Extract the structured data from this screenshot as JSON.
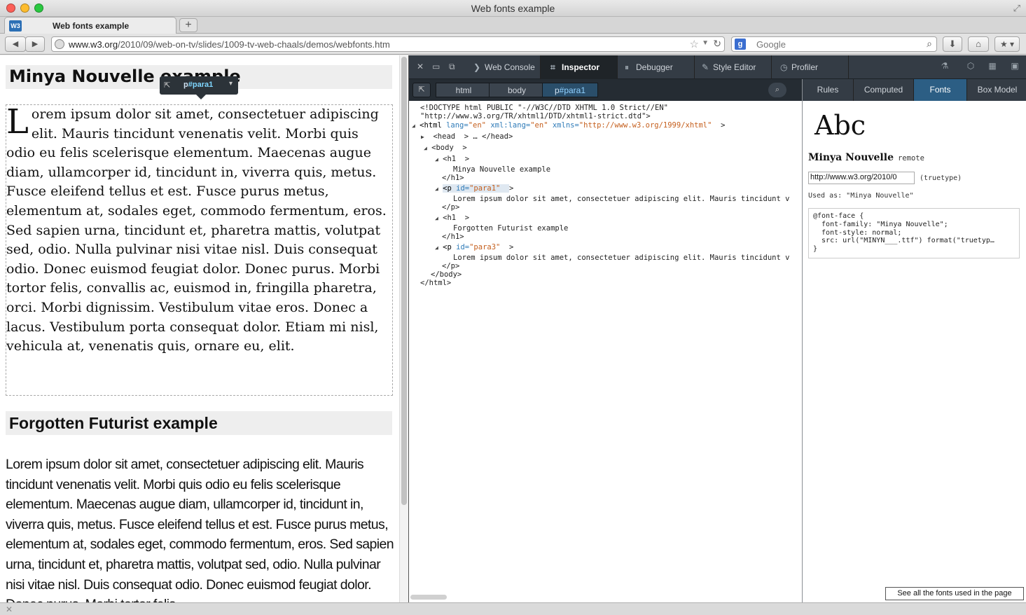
{
  "window": {
    "title": "Web fonts example"
  },
  "tab": {
    "favicon_text": "W3",
    "label": "Web fonts example",
    "new_tab": "+"
  },
  "nav": {
    "url_host": "www.w3.org",
    "url_path": "/2010/09/web-on-tv/slides/1009-tv-web-chaals/demos/webfonts.htm",
    "search_engine_letter": "g",
    "search_placeholder": "Google"
  },
  "page": {
    "h1_minya": "Minya Nouvelle example",
    "para1_dropcap": "L",
    "para1_rest": "orem ipsum dolor sit amet, consectetuer adipiscing elit. Mauris tincidunt venenatis velit. Morbi quis odio eu felis scelerisque elementum. Maecenas augue diam, ullamcorper id, tincidunt in, viverra quis, metus. Fusce eleifend tellus et est. Fusce purus metus, elementum at, sodales eget, commodo fermentum, eros. Sed sapien urna, tincidunt et, pharetra mattis, volutpat sed, odio. Nulla pulvinar nisi vitae nisl. Duis consequat odio. Donec euismod feugiat dolor. Donec purus. Morbi tortor felis, convallis ac, euismod in, fringilla pharetra, orci. Morbi dignissim. Vestibulum vitae eros. Donec a lacus. Vestibulum porta consequat dolor. Etiam mi nisl, vehicula at, venenatis quis, ornare eu, elit.",
    "highlighter_tag": "p",
    "highlighter_id": "#para1",
    "h1_futurist": "Forgotten Futurist example",
    "para3": "Lorem ipsum dolor sit amet, consectetuer adipiscing elit. Mauris tincidunt venenatis velit. Morbi quis odio eu felis scelerisque elementum. Maecenas augue diam, ullamcorper id, tincidunt in, viverra quis, metus. Fusce eleifend tellus et est. Fusce purus metus, elementum at, sodales eget, commodo fermentum, eros. Sed sapien urna, tincidunt et, pharetra mattis, volutpat sed, odio. Nulla pulvinar nisi vitae nisl. Duis consequat odio. Donec euismod feugiat dolor. Donec purus. Morbi tortor felis"
  },
  "devtools": {
    "tabs": {
      "console": "Web Console",
      "inspector": "Inspector",
      "debugger": "Debugger",
      "style_editor": "Style Editor",
      "profiler": "Profiler"
    },
    "breadcrumbs": {
      "html": "html",
      "body": "body",
      "p_tag": "p",
      "p_id": "#para1"
    },
    "markup": {
      "doctype1": "<!DOCTYPE html PUBLIC \"-//W3C//DTD XHTML 1.0 Strict//EN\"",
      "doctype2": "\"http://www.w3.org/TR/xhtml1/DTD/xhtml1-strict.dtd\">",
      "html_open": "<html",
      "html_lang_attr": "lang=",
      "html_lang_val": "\"en\"",
      "html_xmllang_attr": "xml:lang=",
      "html_xmllang_val": "\"en\"",
      "html_xmlns_attr": "xmlns=",
      "html_xmlns_val": "\"http://www.w3.org/1999/xhtml\"",
      "head_line": "<head  > … </head>",
      "body_open": "<body  >",
      "h1_open": "<h1  >",
      "h1_text": "Minya Nouvelle example",
      "h1_close": "</h1>",
      "p1_open": "<p",
      "p_id_attr": "id=",
      "p1_id_val": "\"para1\"",
      "p_text": "Lorem ipsum dolor sit amet, consectetuer adipiscing elit. Mauris tincidunt v",
      "p_close": "</p>",
      "h1b_text": "Forgotten Futurist example",
      "p3_id_val": "\"para3\"",
      "body_close": "</body>",
      "html_close": "</html>"
    },
    "side_tabs": {
      "rules": "Rules",
      "computed": "Computed",
      "fonts": "Fonts",
      "box_model": "Box Model"
    },
    "fonts_panel": {
      "preview": "Abc",
      "font_name": "Minya Nouvelle",
      "source": "remote",
      "url": "http://www.w3.org/2010/0",
      "format": "(truetype)",
      "used_as": "Used as: \"Minya Nouvelle\"",
      "fontface_lines": [
        "@font-face {",
        "  font-family: \"Minya Nouvelle\";",
        "  font-style: normal;",
        "  src: url(\"MINYN___.ttf\") format(\"truetyp…",
        "}"
      ],
      "see_all": "See all the fonts used in the page"
    }
  }
}
